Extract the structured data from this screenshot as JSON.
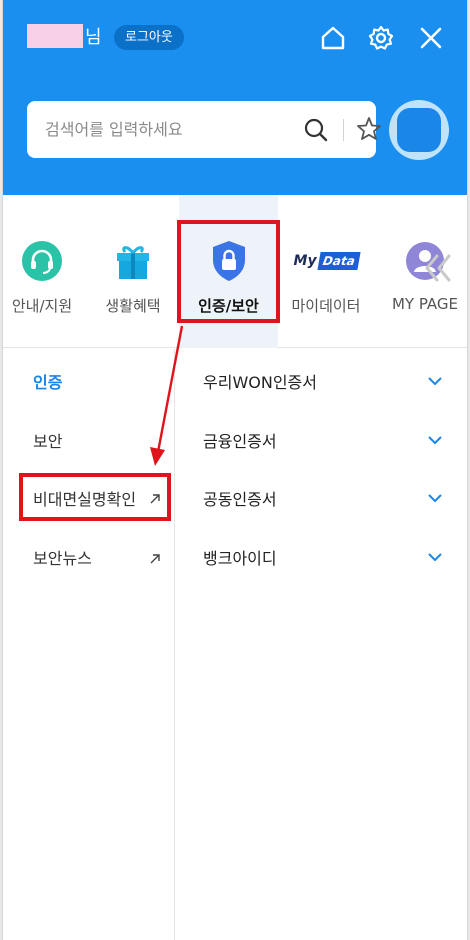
{
  "header": {
    "user_suffix": "님",
    "logout_label": "로그아웃",
    "icons": [
      "home-icon",
      "settings-icon",
      "close-icon"
    ],
    "brand_color": "#1a8ff0"
  },
  "search": {
    "placeholder": "검색어를 입력하세요",
    "value": ""
  },
  "quick_menu": [
    {
      "label": "안내/지원",
      "icon": "headset-icon"
    },
    {
      "label": "생활혜택",
      "icon": "gift-icon"
    },
    {
      "label": "인증/보안",
      "icon": "shield-lock-icon",
      "active": true
    },
    {
      "label": "마이데이터",
      "icon": "mydata-icon",
      "icon_text_my": "My",
      "icon_text_data": "Data"
    },
    {
      "label": "MY PAGE",
      "icon": "person-icon"
    }
  ],
  "left_nav": [
    {
      "label": "인증",
      "active": true
    },
    {
      "label": "보안"
    },
    {
      "label": "비대면실명확인",
      "external": true
    },
    {
      "label": "보안뉴스",
      "external": true
    }
  ],
  "cert_list": [
    {
      "label": "우리WON인증서"
    },
    {
      "label": "금융인증서"
    },
    {
      "label": "공동인증서"
    },
    {
      "label": "뱅크아이디"
    }
  ],
  "accent_color": "#1a86e8",
  "highlight_color": "#e0151b"
}
